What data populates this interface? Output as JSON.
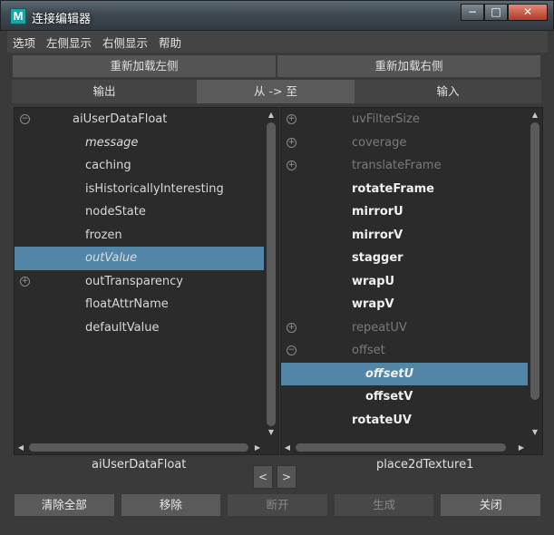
{
  "window": {
    "title": "连接编辑器",
    "icon_letter": "M",
    "min": "−",
    "max": "□",
    "close": "✕"
  },
  "menu": [
    "选项",
    "左侧显示",
    "右侧显示",
    "帮助"
  ],
  "reload": {
    "left": "重新加载左侧",
    "right": "重新加载右侧"
  },
  "modes": {
    "output": "输出",
    "from_to": "从 -> 至",
    "input": "输入"
  },
  "left_panel": {
    "rows": [
      {
        "label": "aiUserDataFloat",
        "style": "normal",
        "expander": "minus",
        "indent": 1
      },
      {
        "label": "message",
        "style": "italic",
        "expander": null,
        "indent": 2
      },
      {
        "label": "caching",
        "style": "normal",
        "expander": null,
        "indent": 2
      },
      {
        "label": "isHistoricallyInteresting",
        "style": "normal",
        "expander": null,
        "indent": 2
      },
      {
        "label": "nodeState",
        "style": "normal",
        "expander": null,
        "indent": 2
      },
      {
        "label": "frozen",
        "style": "normal",
        "expander": null,
        "indent": 2
      },
      {
        "label": "outValue",
        "style": "italic",
        "expander": null,
        "indent": 2,
        "selected": true
      },
      {
        "label": "outTransparency",
        "style": "normal",
        "expander": "plus",
        "indent": 2
      },
      {
        "label": "floatAttrName",
        "style": "normal",
        "expander": null,
        "indent": 2
      },
      {
        "label": "defaultValue",
        "style": "normal",
        "expander": null,
        "indent": 2
      }
    ]
  },
  "right_panel": {
    "rows": [
      {
        "label": "uvFilterSize",
        "style": "dim",
        "expander": "plus",
        "indent": 1
      },
      {
        "label": "coverage",
        "style": "dim",
        "expander": "plus",
        "indent": 1
      },
      {
        "label": "translateFrame",
        "style": "dim",
        "expander": "plus",
        "indent": 1
      },
      {
        "label": "rotateFrame",
        "style": "bold",
        "expander": null,
        "indent": 1
      },
      {
        "label": "mirrorU",
        "style": "bold",
        "expander": null,
        "indent": 1
      },
      {
        "label": "mirrorV",
        "style": "bold",
        "expander": null,
        "indent": 1
      },
      {
        "label": "stagger",
        "style": "bold",
        "expander": null,
        "indent": 1
      },
      {
        "label": "wrapU",
        "style": "bold",
        "expander": null,
        "indent": 1
      },
      {
        "label": "wrapV",
        "style": "bold",
        "expander": null,
        "indent": 1
      },
      {
        "label": "repeatUV",
        "style": "dim",
        "expander": "plus",
        "indent": 1
      },
      {
        "label": "offset",
        "style": "dim",
        "expander": "minus",
        "indent": 1
      },
      {
        "label": "offsetU",
        "style": "bold italic",
        "expander": null,
        "indent": 2,
        "selected": true
      },
      {
        "label": "offsetV",
        "style": "bold",
        "expander": null,
        "indent": 2
      },
      {
        "label": "rotateUV",
        "style": "bold",
        "expander": null,
        "indent": 1
      }
    ]
  },
  "nodes": {
    "left": "aiUserDataFloat",
    "right": "place2dTexture1"
  },
  "swap": {
    "prev": "<",
    "next": ">"
  },
  "buttons": [
    {
      "label": "清除全部",
      "enabled": true
    },
    {
      "label": "移除",
      "enabled": true
    },
    {
      "label": "断开",
      "enabled": false
    },
    {
      "label": "生成",
      "enabled": false
    },
    {
      "label": "关闭",
      "enabled": true
    }
  ],
  "icons": {
    "expand": "⊕",
    "collapse": "⊖",
    "arrow_up": "▲",
    "arrow_down": "▼",
    "arrow_left": "◀",
    "arrow_right": "▶"
  }
}
